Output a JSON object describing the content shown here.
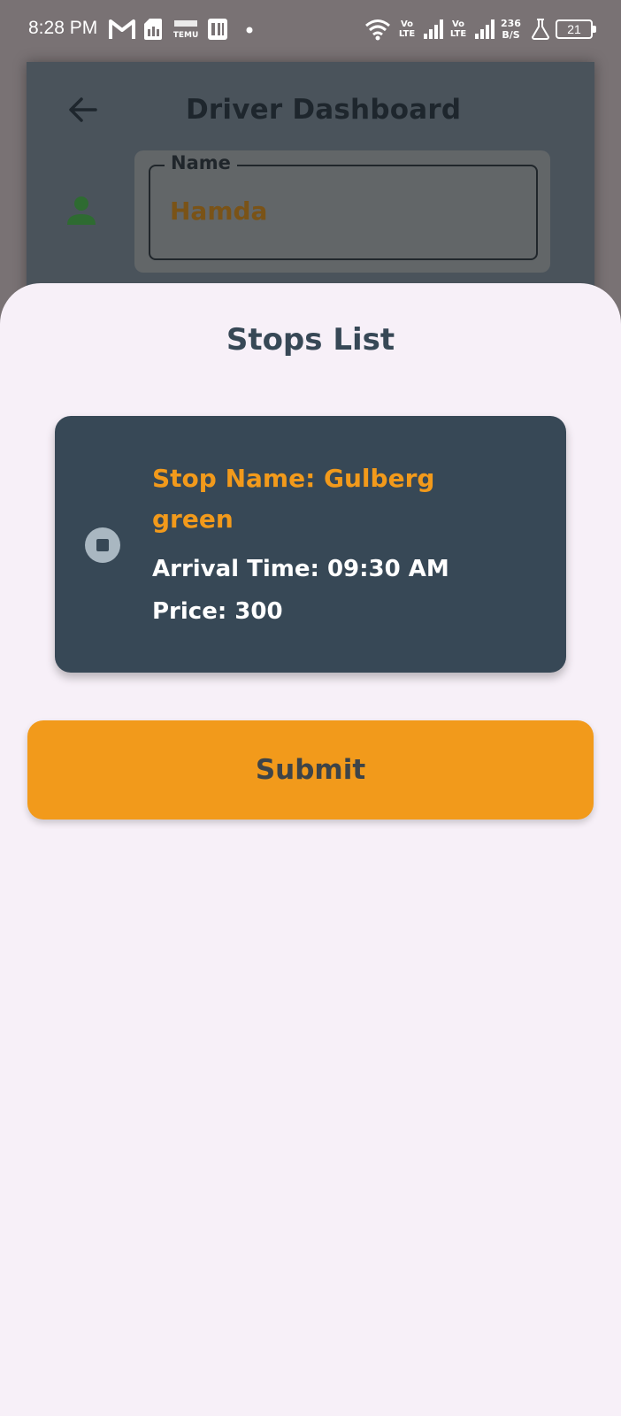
{
  "status_bar": {
    "time": "8:28 PM",
    "volte1": "Vo LTE",
    "volte2": "Vo LTE",
    "net_speed_value": "236",
    "net_speed_unit": "B/S",
    "battery": "21",
    "icons": [
      "gmail-icon",
      "sim-card-icon",
      "temu-icon",
      "app-notification-icon",
      "dot-icon",
      "wifi-icon",
      "signal-icon",
      "signal-icon",
      "flask-icon",
      "battery-icon"
    ]
  },
  "page": {
    "title": "Driver Dashboard",
    "name_field": {
      "label": "Name",
      "value": "Hamda"
    }
  },
  "sheet": {
    "title": "Stops List",
    "stops": [
      {
        "name": "Stop Name: Gulberg green",
        "arrival": "Arrival Time: 09:30 AM",
        "price": "Price: 300"
      }
    ],
    "submit_label": "Submit"
  },
  "colors": {
    "accent": "#f29a1b",
    "card": "#374856",
    "sheet_bg": "#f7f0f8",
    "person_icon": "#2e6b31"
  }
}
